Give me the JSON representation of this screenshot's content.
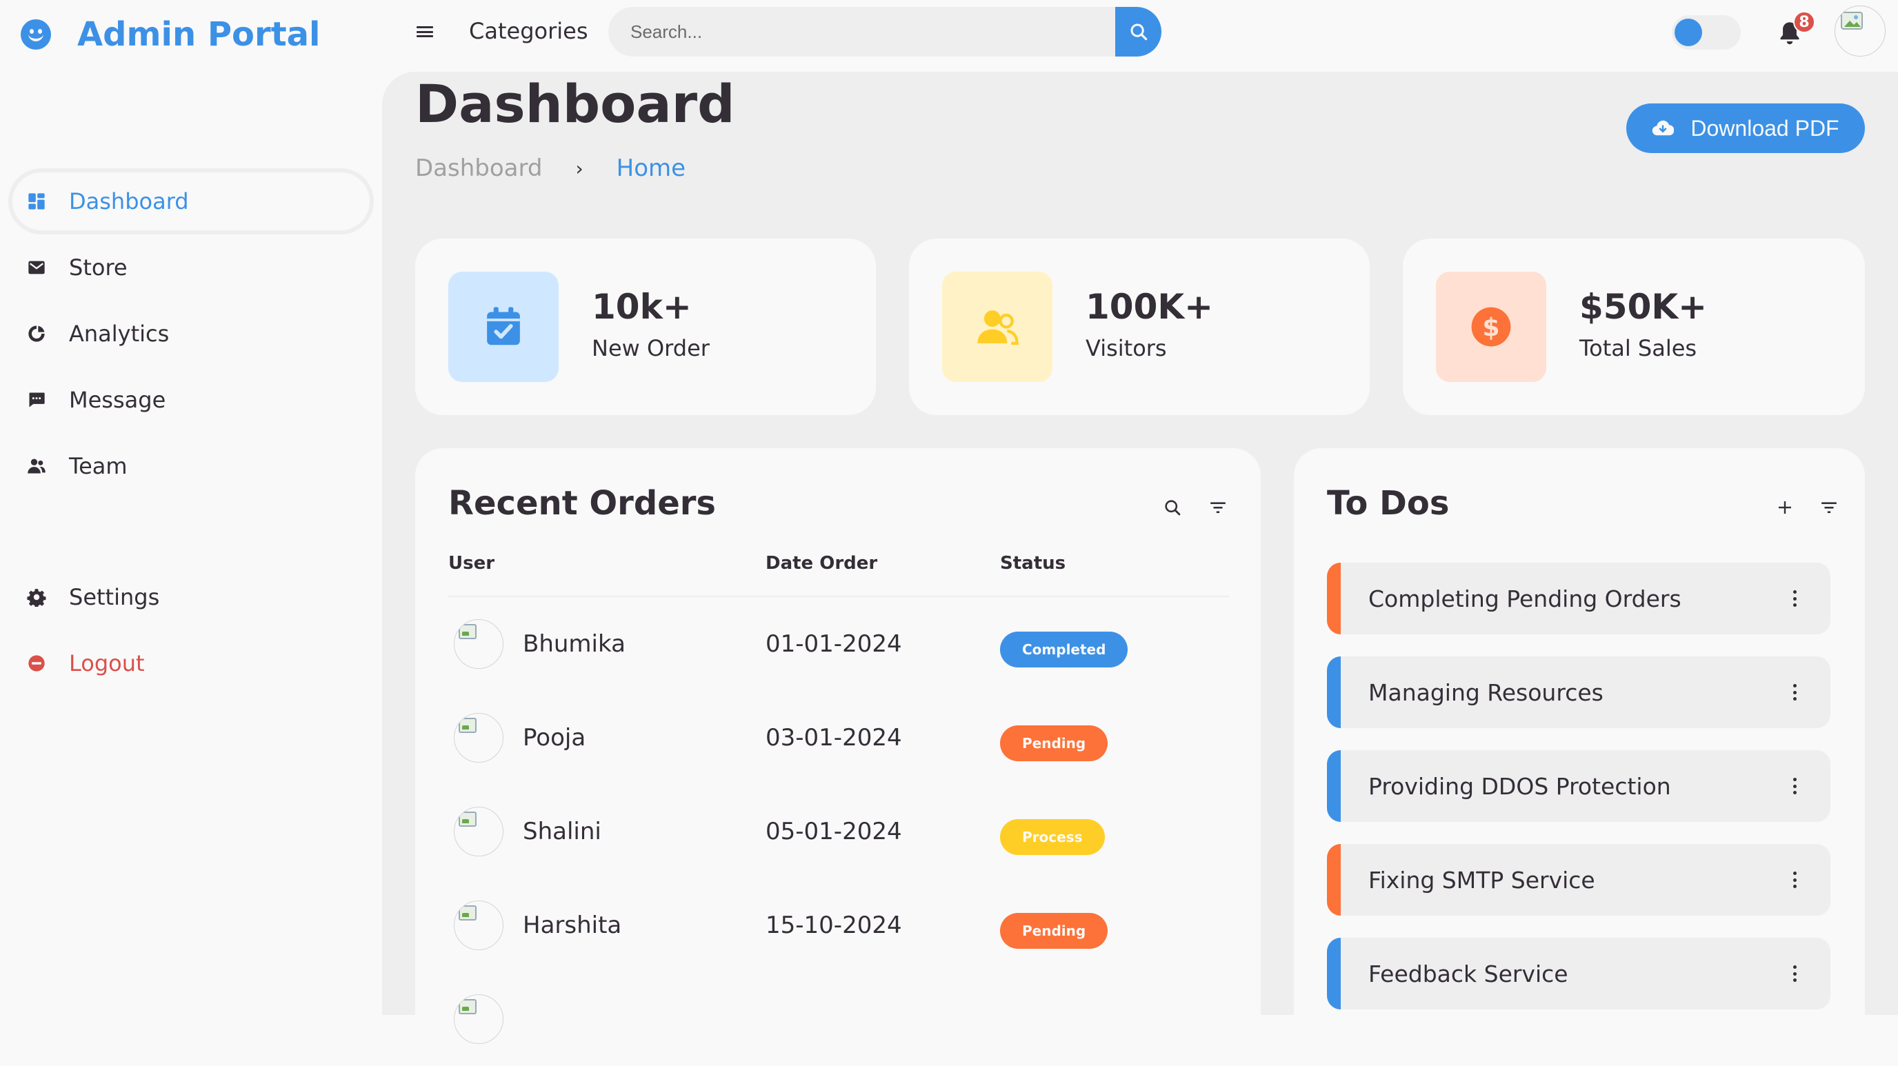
{
  "brand": {
    "name": "Admin Portal"
  },
  "topbar": {
    "categories_label": "Categories",
    "search_placeholder": "Search...",
    "notification_count": "8"
  },
  "sidebar": {
    "items": [
      {
        "label": "Dashboard",
        "icon": "dashboard-icon",
        "active": true
      },
      {
        "label": "Store",
        "icon": "store-icon"
      },
      {
        "label": "Analytics",
        "icon": "analytics-icon"
      },
      {
        "label": "Message",
        "icon": "message-icon"
      },
      {
        "label": "Team",
        "icon": "team-icon"
      }
    ],
    "bottom": [
      {
        "label": "Settings",
        "icon": "gear-icon"
      },
      {
        "label": "Logout",
        "icon": "logout-icon"
      }
    ]
  },
  "page": {
    "title": "Dashboard",
    "breadcrumb": [
      "Dashboard",
      "Home"
    ],
    "breadcrumb_separator": "›",
    "download_label": "Download PDF"
  },
  "stats": [
    {
      "value": "10k+",
      "label": "New Order",
      "icon": "calendar-check-icon",
      "bg": "#cfe8ff",
      "color": "#3c91e6"
    },
    {
      "value": "100K+",
      "label": "Visitors",
      "icon": "group-icon",
      "bg": "#fff2c6",
      "color": "#ffce26"
    },
    {
      "value": "$50K+",
      "label": "Total Sales",
      "icon": "dollar-circle-icon",
      "bg": "#ffe0d3",
      "color": "#fd7238"
    }
  ],
  "orders": {
    "title": "Recent Orders",
    "columns": [
      "User",
      "Date Order",
      "Status"
    ],
    "rows": [
      {
        "user": "Bhumika",
        "date": "01-01-2024",
        "status": "Completed",
        "status_color": "#3c91e6"
      },
      {
        "user": "Pooja",
        "date": "03-01-2024",
        "status": "Pending",
        "status_color": "#fd7238"
      },
      {
        "user": "Shalini",
        "date": "05-01-2024",
        "status": "Process",
        "status_color": "#ffce26"
      },
      {
        "user": "Harshita",
        "date": "15-10-2024",
        "status": "Pending",
        "status_color": "#fd7238"
      }
    ]
  },
  "todos": {
    "title": "To Dos",
    "items": [
      {
        "text": "Completing Pending Orders",
        "color": "#fd7238"
      },
      {
        "text": "Managing Resources",
        "color": "#3c91e6"
      },
      {
        "text": "Providing DDOS Protection",
        "color": "#3c91e6"
      },
      {
        "text": "Fixing SMTP Service",
        "color": "#fd7238"
      },
      {
        "text": "Feedback Service",
        "color": "#3c91e6"
      }
    ]
  },
  "colors": {
    "blue": "#3c91e6",
    "light": "#f9f9f9",
    "grey": "#eeeeee",
    "dark": "#342e37",
    "red": "#db504a",
    "yellow": "#ffce26",
    "orange": "#fd7238"
  }
}
